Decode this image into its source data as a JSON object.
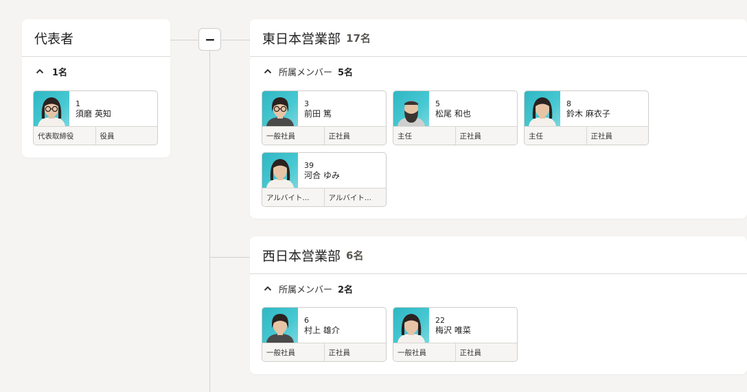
{
  "representative": {
    "title": "代表者",
    "collapse_count": "1名",
    "members": [
      {
        "num": "1",
        "name": "須磨 英知",
        "tags": [
          "代表取締役",
          "役員"
        ],
        "avatar": "avatar-glasses-woman"
      }
    ]
  },
  "toggle": {
    "icon": "minus-icon"
  },
  "departments": [
    {
      "title": "東日本営業部",
      "count": "17名",
      "collapse_label": "所属メンバー",
      "collapse_count": "5名",
      "members": [
        {
          "num": "3",
          "name": "前田 篤",
          "tags": [
            "一般社員",
            "正社員"
          ],
          "avatar": "avatar-glasses-man"
        },
        {
          "num": "5",
          "name": "松尾 和也",
          "tags": [
            "主任",
            "正社員"
          ],
          "avatar": "avatar-bearded-man"
        },
        {
          "num": "8",
          "name": "鈴木 麻衣子",
          "tags": [
            "主任",
            "正社員"
          ],
          "avatar": "avatar-woman"
        },
        {
          "num": "39",
          "name": "河合 ゆみ",
          "tags": [
            "アルバイト...",
            "アルバイト..."
          ],
          "avatar": "avatar-woman-2"
        }
      ]
    },
    {
      "title": "西日本営業部",
      "count": "6名",
      "collapse_label": "所属メンバー",
      "collapse_count": "2名",
      "members": [
        {
          "num": "6",
          "name": "村上 雄介",
          "tags": [
            "一般社員",
            "正社員"
          ],
          "avatar": "avatar-man"
        },
        {
          "num": "22",
          "name": "梅沢 唯菜",
          "tags": [
            "一般社員",
            "正社員"
          ],
          "avatar": "avatar-woman-3"
        }
      ]
    }
  ]
}
